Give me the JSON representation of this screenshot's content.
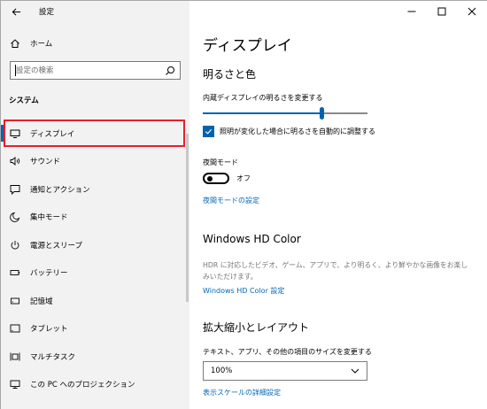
{
  "window": {
    "title": "設定",
    "controls": [
      "minimize",
      "maximize",
      "close"
    ]
  },
  "sidebar": {
    "home_label": "ホーム",
    "search": {
      "value": "",
      "placeholder": "設定の検索"
    },
    "section_label": "システム",
    "items": [
      {
        "label": "ディスプレイ",
        "icon": "monitor-icon",
        "selected": true
      },
      {
        "label": "サウンド",
        "icon": "speaker-icon"
      },
      {
        "label": "通知とアクション",
        "icon": "message-icon"
      },
      {
        "label": "集中モード",
        "icon": "moon-icon"
      },
      {
        "label": "電源とスリープ",
        "icon": "power-icon"
      },
      {
        "label": "バッテリー",
        "icon": "battery-icon"
      },
      {
        "label": "記憶域",
        "icon": "storage-icon"
      },
      {
        "label": "タブレット",
        "icon": "tablet-icon"
      },
      {
        "label": "マルチタスク",
        "icon": "multitask-icon"
      },
      {
        "label": "この PC へのプロジェクション",
        "icon": "projection-icon"
      }
    ]
  },
  "main": {
    "page_title": "ディスプレイ",
    "brightness": {
      "heading": "明るさと色",
      "slider_label": "内蔵ディスプレイの明るさを変更する",
      "slider_value": 0.72,
      "checkbox_label": "照明が変化した場合に明るさを自動的に調整する",
      "checkbox_checked": true
    },
    "night_mode": {
      "label": "夜間モード",
      "state_label": "オフ",
      "on": false,
      "settings_link": "夜間モードの設定"
    },
    "hdr": {
      "heading": "Windows HD Color",
      "description": "HDR に対応したビデオ、ゲーム、アプリで、より明るく、より鮮やかな画像をお楽しみいただけます。",
      "link": "Windows HD Color 設定"
    },
    "scale": {
      "heading": "拡大縮小とレイアウト",
      "label": "テキスト、アプリ、その他の項目のサイズを変更する",
      "dropdown_value": "100%",
      "link": "表示スケールの詳細設定"
    }
  },
  "colors": {
    "accent": "#0063b1",
    "link": "#0067b8",
    "highlight": "#e8202a",
    "sidebar_bg": "#f2f2f2"
  }
}
